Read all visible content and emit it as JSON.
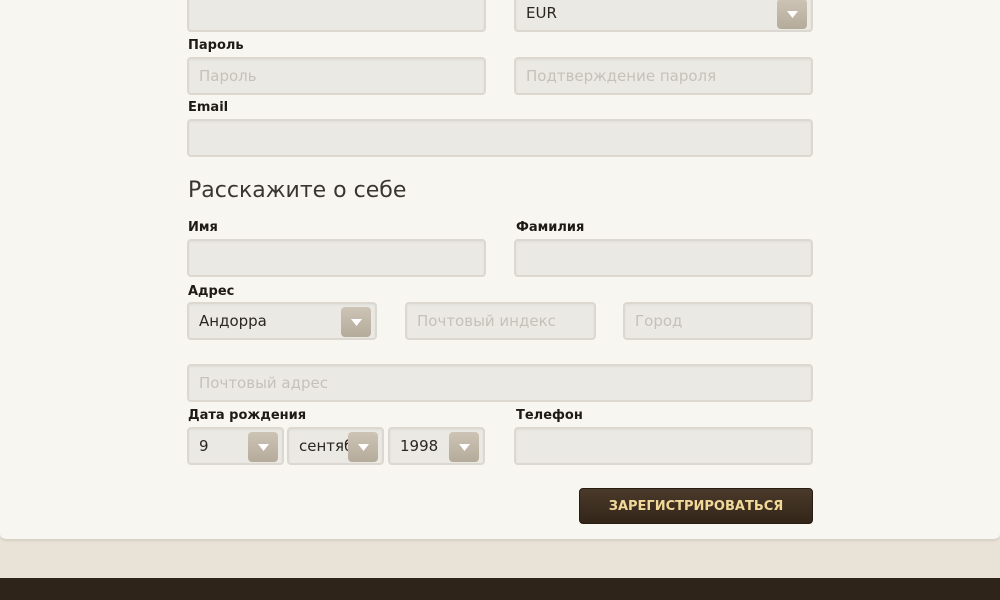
{
  "account": {
    "currency_value": "EUR",
    "password_label": "Пароль",
    "password_placeholder": "Пароль",
    "confirm_placeholder": "Подтверждение пароля",
    "email_label": "Email"
  },
  "about": {
    "heading": "Расскажите о себе",
    "first_name_label": "Имя",
    "last_name_label": "Фамилия",
    "address_label": "Адрес",
    "country_value": "Андорра",
    "zip_placeholder": "Почтовый индекс",
    "city_placeholder": "Город",
    "postal_address_placeholder": "Почтовый адрес",
    "birthdate_label": "Дата рождения",
    "day_value": "9",
    "month_value": "сентября",
    "year_value": "1998",
    "phone_label": "Телефон"
  },
  "actions": {
    "register_label": "ЗАРЕГИСТРИРОВАТЬСЯ"
  },
  "icons": {
    "dropdown": "chevron-down-icon"
  },
  "colors": {
    "button_bg": "#3b2c1f",
    "button_text": "#f2d99a",
    "field_bg": "#ebe9e4",
    "page_bg": "#f8f6f1"
  }
}
